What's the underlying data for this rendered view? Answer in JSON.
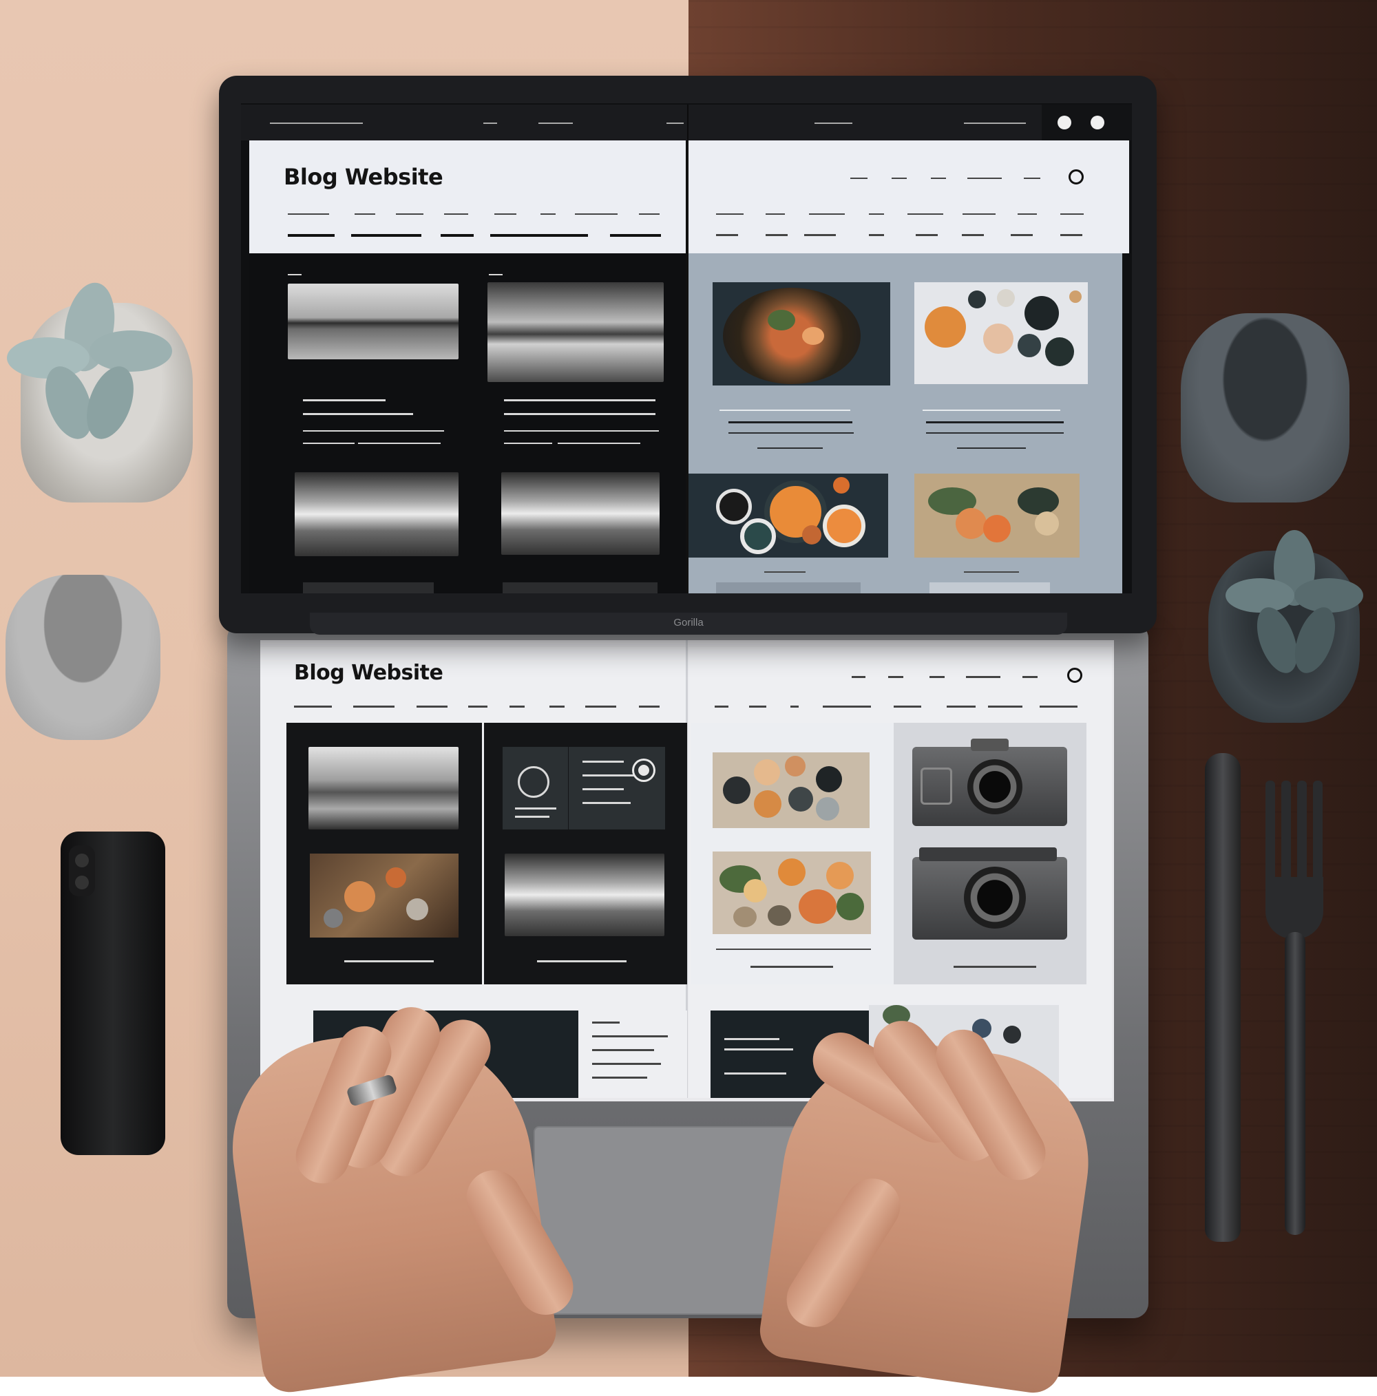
{
  "scene": {
    "description_colors": {
      "desk_left": "#e6c3ac",
      "desk_right": "#4a2b20",
      "laptop": "#1c1d20"
    }
  },
  "screen": {
    "top": {
      "logo": "Blog  Website"
    },
    "bottom": {
      "logo": "Blog Website"
    }
  },
  "device": {
    "hinge_label": "Gorilla"
  }
}
